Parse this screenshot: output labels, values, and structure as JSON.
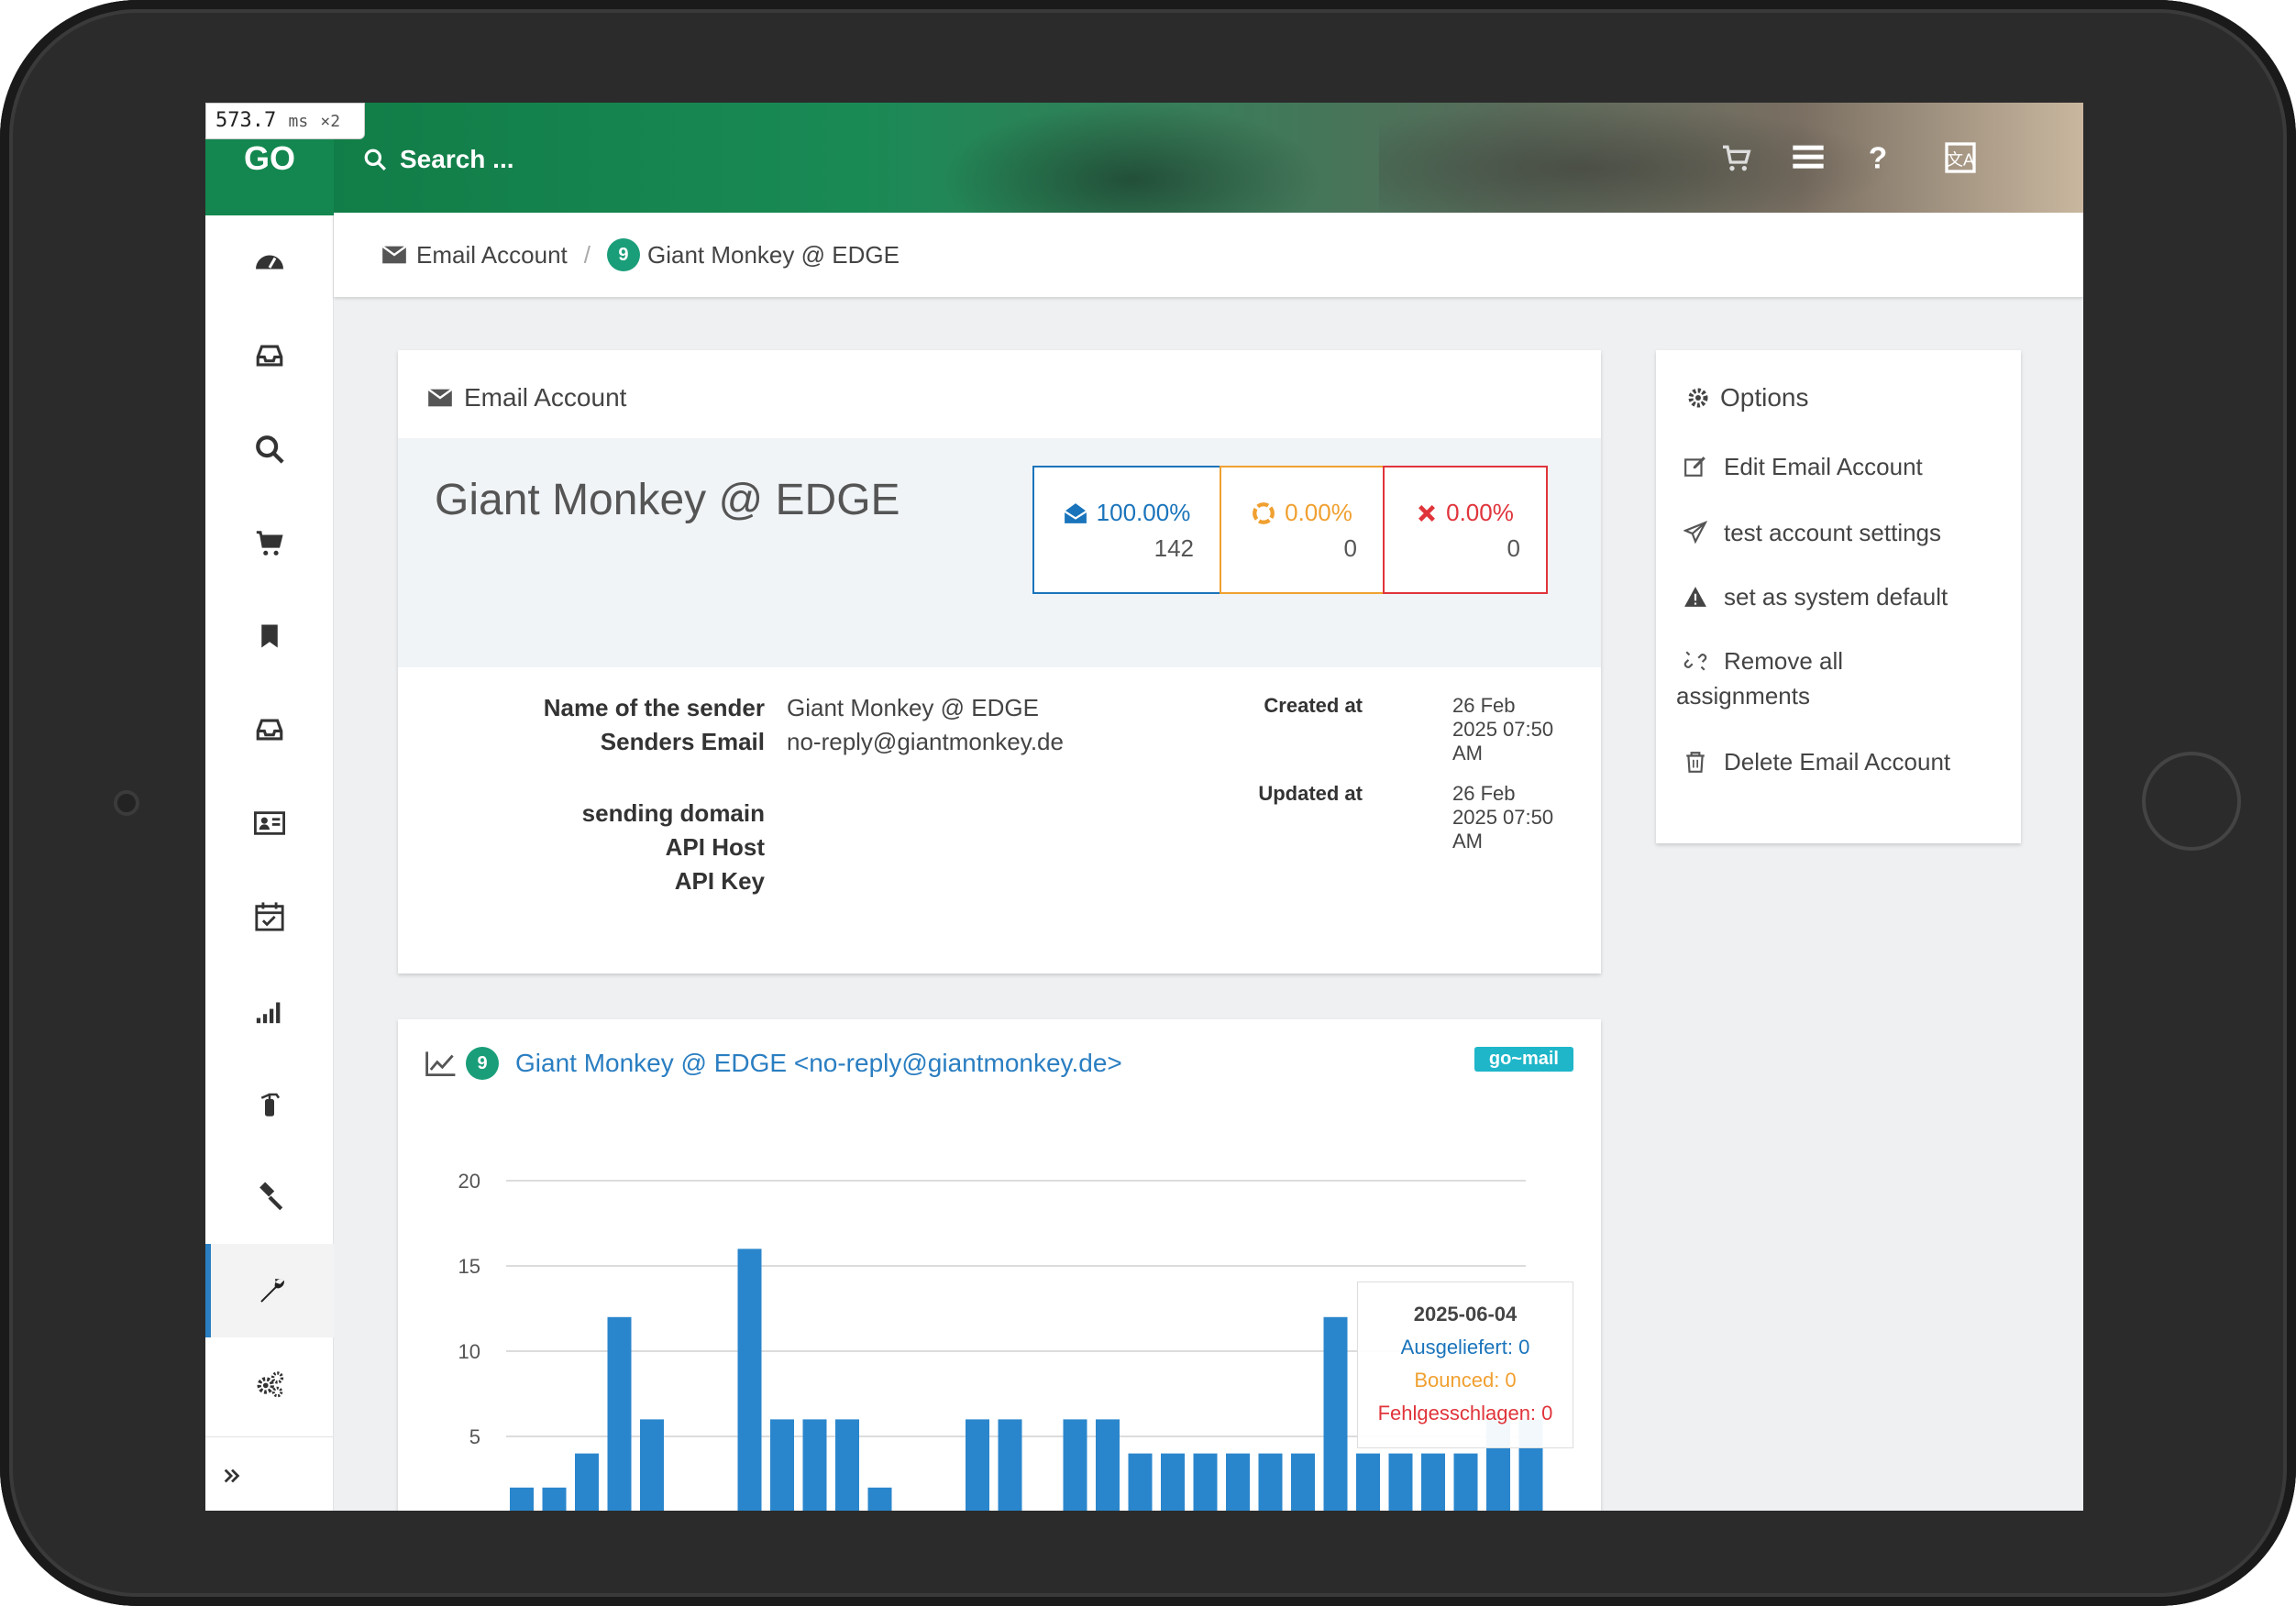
{
  "perf": {
    "value": "573.7",
    "unit": "ms",
    "mult": "×2"
  },
  "app": {
    "logo": "GO"
  },
  "topbar": {
    "search_label": "Search ..."
  },
  "breadcrumb": {
    "root": "Email Account",
    "badge": "9",
    "current": "Giant Monkey @ EDGE"
  },
  "account_card": {
    "title": "Email Account",
    "name": "Giant Monkey @ EDGE",
    "stats": [
      {
        "percent": "100.00%",
        "count": "142",
        "color": "#1a74bb",
        "icon": "envelope-open-icon"
      },
      {
        "percent": "0.00%",
        "count": "0",
        "color": "#f0a030",
        "icon": "life-ring-icon"
      },
      {
        "percent": "0.00%",
        "count": "0",
        "color": "#e0343b",
        "icon": "x-icon"
      }
    ],
    "labels": {
      "sender_name": "Name of the sender",
      "sender_email": "Senders Email",
      "sending_domain": "sending domain",
      "api_host": "API Host",
      "api_key": "API Key",
      "created": "Created at",
      "updated": "Updated at"
    },
    "values": {
      "sender_name": "Giant Monkey @ EDGE",
      "sender_email": "no-reply@giantmonkey.de",
      "created_1": "26 Feb",
      "created_2": "2025 07:50",
      "created_3": "AM",
      "updated_1": "26 Feb",
      "updated_2": "2025 07:50",
      "updated_3": "AM"
    }
  },
  "options": {
    "title": "Options",
    "items": [
      {
        "label": "Edit Email Account",
        "icon": "edit-icon"
      },
      {
        "label": "test account settings",
        "icon": "paper-plane-icon"
      },
      {
        "label": "set as system default",
        "icon": "warning-icon"
      },
      {
        "label_1": "Remove all",
        "label_2": "assignments",
        "icon": "unlink-icon"
      },
      {
        "label": "Delete Email Account",
        "icon": "trash-icon"
      }
    ]
  },
  "chart_card": {
    "badge": "9",
    "title": "Giant Monkey @ EDGE <no-reply@giantmonkey.de>",
    "tag": "go~mail",
    "tooltip": {
      "date": "2025-06-04",
      "delivered": "Ausgeliefert: 0",
      "bounced": "Bounced: 0",
      "failed": "Fehlgesschlagen: 0"
    }
  },
  "chart_data": {
    "type": "bar",
    "title": "",
    "xlabel": "",
    "ylabel": "",
    "ylim": [
      0,
      20
    ],
    "yticks": [
      5,
      10,
      15,
      20
    ],
    "grid": true,
    "series": [
      {
        "name": "Ausgeliefert",
        "color": "#2a86cc",
        "values": [
          2,
          2,
          4,
          12,
          6,
          0,
          0,
          16,
          6,
          6,
          6,
          2,
          0,
          0,
          6,
          6,
          0,
          6,
          6,
          4,
          4,
          4,
          4,
          4,
          4,
          12,
          4,
          4,
          4,
          4,
          6,
          6
        ]
      }
    ]
  },
  "sidebar": {
    "items": [
      {
        "icon": "dashboard-icon"
      },
      {
        "icon": "inbox-icon"
      },
      {
        "icon": "search-icon"
      },
      {
        "icon": "cart-icon"
      },
      {
        "icon": "bookmark-icon"
      },
      {
        "icon": "inbox-icon"
      },
      {
        "icon": "contact-card-icon"
      },
      {
        "icon": "calendar-check-icon"
      },
      {
        "icon": "signal-icon"
      },
      {
        "icon": "extinguisher-icon"
      },
      {
        "icon": "gavel-icon"
      },
      {
        "icon": "wrench-icon"
      },
      {
        "icon": "gears-icon"
      }
    ],
    "active_index": 11
  }
}
